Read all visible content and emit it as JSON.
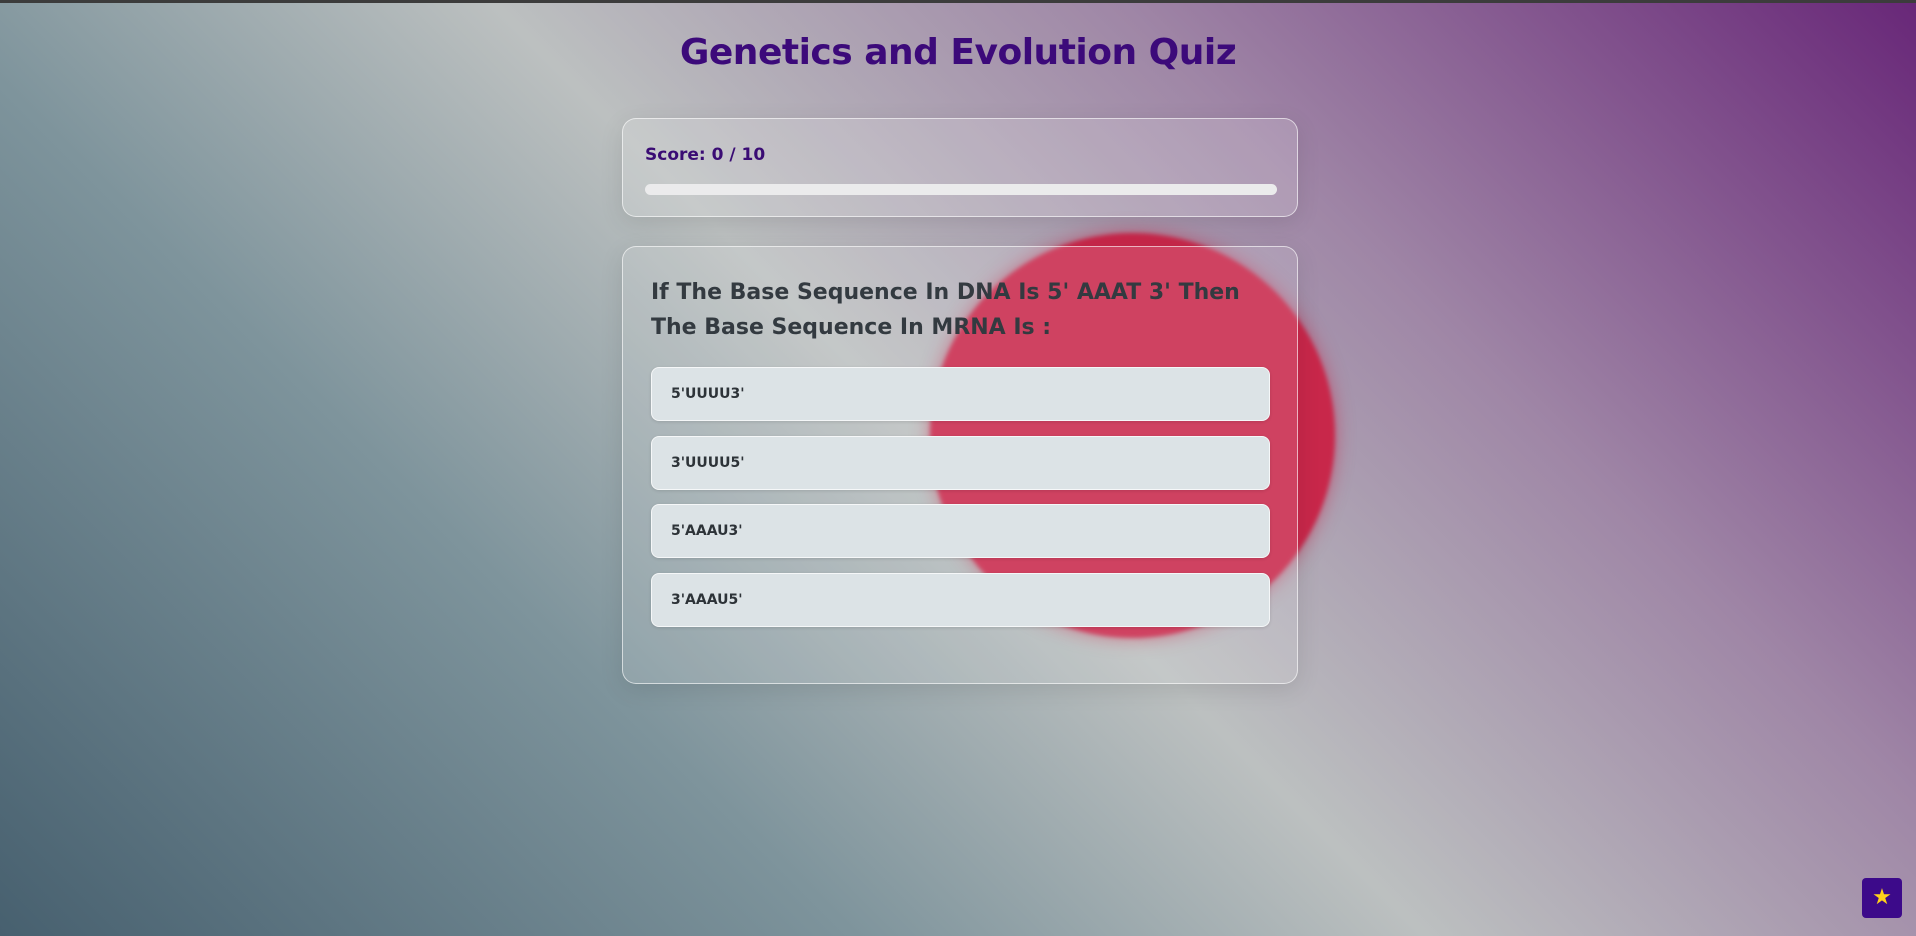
{
  "title": "Genetics and Evolution Quiz",
  "score": {
    "label": "Score: 0 / 10",
    "progress": 0
  },
  "question": {
    "text": "If The Base Sequence In DNA Is 5' AAAT 3' Then The Base Sequence In MRNA Is :",
    "options": [
      {
        "label": "5'UUUU3'"
      },
      {
        "label": "3'UUUU5'"
      },
      {
        "label": "5'AAAU3'"
      },
      {
        "label": "3'AAAU5'"
      }
    ]
  },
  "star_button": {
    "icon": "star-icon",
    "glyph": "★"
  },
  "colors": {
    "accent": "#3c0a7a",
    "blob": "#c8274a",
    "star": "#ffd21a"
  }
}
